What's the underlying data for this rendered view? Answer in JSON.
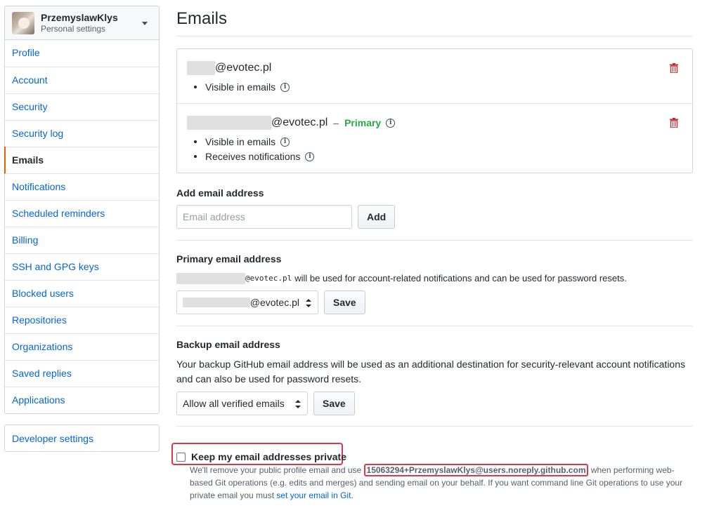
{
  "sidebar": {
    "user": {
      "name": "PrzemyslawKlys",
      "subtitle": "Personal settings"
    },
    "items": [
      {
        "label": "Profile",
        "selected": false
      },
      {
        "label": "Account",
        "selected": false
      },
      {
        "label": "Security",
        "selected": false
      },
      {
        "label": "Security log",
        "selected": false
      },
      {
        "label": "Emails",
        "selected": true
      },
      {
        "label": "Notifications",
        "selected": false
      },
      {
        "label": "Scheduled reminders",
        "selected": false
      },
      {
        "label": "Billing",
        "selected": false
      },
      {
        "label": "SSH and GPG keys",
        "selected": false
      },
      {
        "label": "Blocked users",
        "selected": false
      },
      {
        "label": "Repositories",
        "selected": false
      },
      {
        "label": "Organizations",
        "selected": false
      },
      {
        "label": "Saved replies",
        "selected": false
      },
      {
        "label": "Applications",
        "selected": false
      }
    ],
    "developer": "Developer settings"
  },
  "main": {
    "title": "Emails",
    "emails": [
      {
        "address": "@evotec.pl",
        "visible": "Visible in emails"
      },
      {
        "address": "@evotec.pl",
        "primary_sep": "–",
        "primary": "Primary",
        "visible": "Visible in emails",
        "notifications": "Receives notifications"
      }
    ],
    "add": {
      "heading": "Add email address",
      "placeholder": "Email address",
      "button": "Add"
    },
    "primary_section": {
      "heading": "Primary email address",
      "mono": "@evotec.pl",
      "note": "will be used for account-related notifications and can be used for password resets.",
      "select_value": "@evotec.pl",
      "button": "Save"
    },
    "backup": {
      "heading": "Backup email address",
      "text": "Your backup GitHub email address will be used as an additional destination for security-relevant account notifications and can also be used for password resets.",
      "select_value": "Allow all verified emails",
      "button": "Save"
    },
    "private": {
      "label": "Keep my email addresses private",
      "note_before": "We'll remove your public profile email and use",
      "noreply": "15063294+PrzemyslawKlys@users.noreply.github.com",
      "note_after": "when performing web-based Git operations (e.g. edits and merges) and sending email on your behalf. If you want command line Git operations to use your private email you must",
      "link": "set your email in Git",
      "end": "."
    }
  },
  "colors": {
    "link": "#0366d6",
    "primary": "#28a745",
    "danger": "#cb2431",
    "highlight": "#d73a49",
    "selected_bar": "#e36209"
  }
}
